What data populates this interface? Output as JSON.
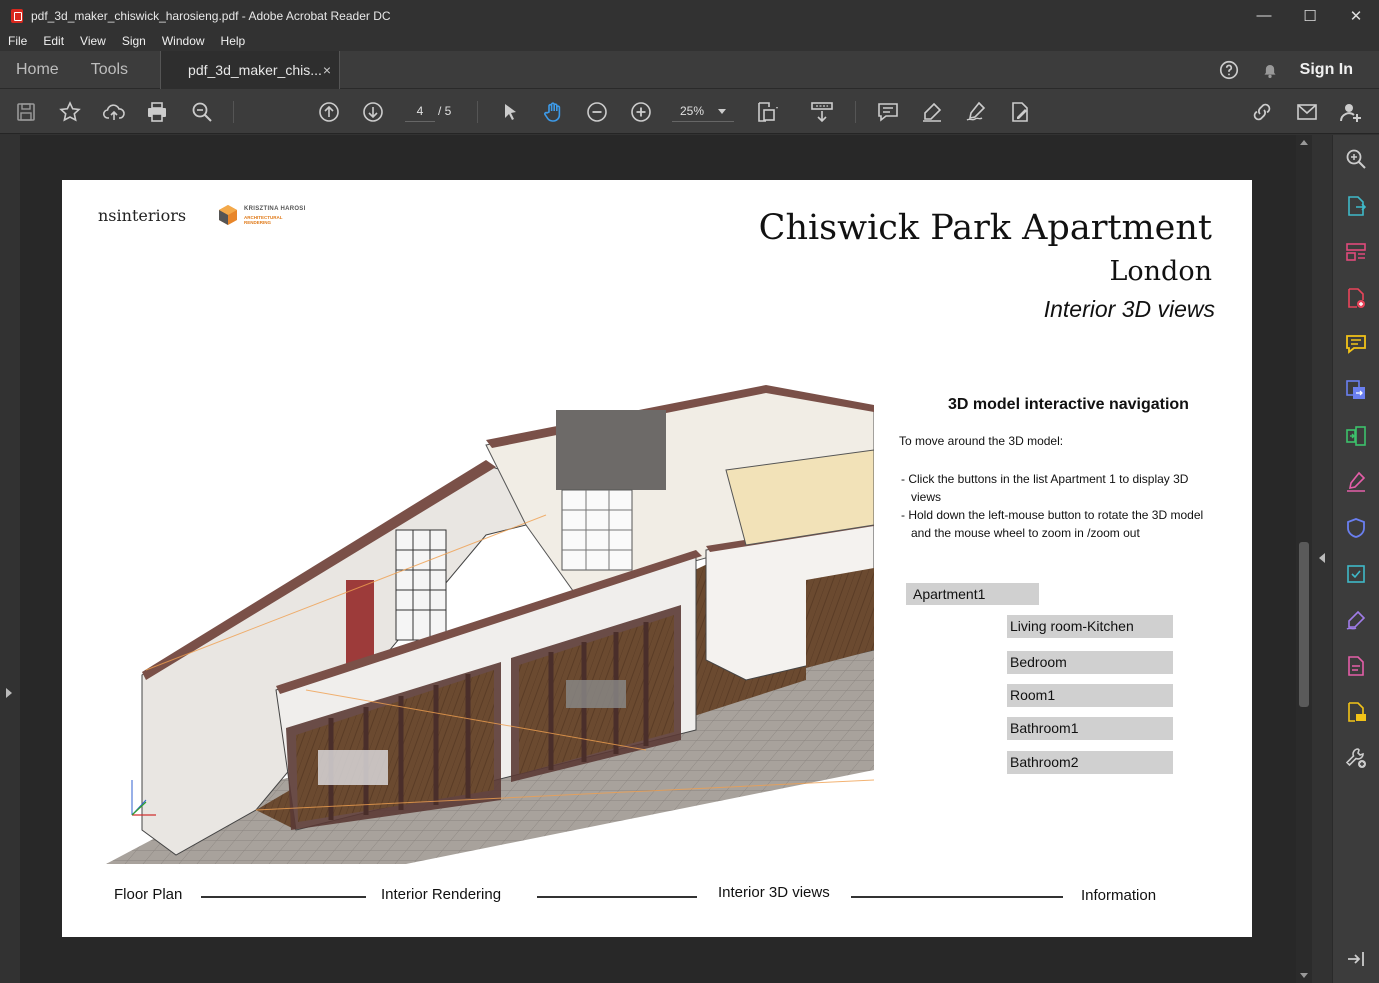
{
  "window": {
    "title": "pdf_3d_maker_chiswick_harosieng.pdf - Adobe Acrobat Reader DC",
    "controls": [
      "—",
      "☐",
      "✕"
    ]
  },
  "menu": [
    "File",
    "Edit",
    "View",
    "Sign",
    "Window",
    "Help"
  ],
  "tabs": {
    "home": "Home",
    "tools": "Tools",
    "document": "pdf_3d_maker_chis...",
    "close": "×",
    "sign_in": "Sign In"
  },
  "toolbar": {
    "page_current": "4",
    "page_total": "/ 5",
    "zoom": "25%"
  },
  "document": {
    "logo_text": "nsinteriors",
    "logo2_line1": "KRISZTINA HAROSI",
    "logo2_line2": "ARCHITECTURAL RENDERING",
    "title": "Chiswick Park Apartment",
    "subtitle": "London",
    "subtitle2": "Interior 3D views",
    "nav": {
      "heading": "3D model interactive navigation",
      "intro": "To move around the 3D model:",
      "bullets": [
        "- Click the buttons in the list Apartment 1 to display 3D views",
        "- Hold down the left-mouse button to rotate the 3D model and the mouse wheel to zoom in /zoom out"
      ],
      "apartment_button": "Apartment1",
      "rooms": [
        "Living room-Kitchen",
        "Bedroom",
        "Room1",
        "Bathroom1",
        "Bathroom2"
      ]
    },
    "footer_nav": [
      "Floor Plan",
      "Interior Rendering",
      "Interior 3D views",
      "Information"
    ]
  },
  "colors": {
    "chrome_dark": "#323232",
    "chrome_mid": "#3c3c3c",
    "doc_bg": "#282828",
    "hand_tool_active": "#3d9ae8",
    "button_gray": "#d0d0d0",
    "wall_brown": "#7a5048"
  },
  "icons": {
    "toolbar": [
      "save-icon",
      "bookmark-star-icon",
      "upload-cloud-icon",
      "print-icon",
      "find-zoom-icon",
      "page-up-icon",
      "page-down-icon",
      "select-arrow-icon",
      "hand-icon",
      "zoom-out-icon",
      "zoom-in-icon",
      "fit-page-icon",
      "scroll-mode-icon",
      "comment-icon",
      "highlight-pen-icon",
      "sign-icon",
      "fill-sign-icon",
      "share-link-icon",
      "email-icon",
      "add-user-icon"
    ],
    "right_panel": [
      "search-zoom-icon",
      "export-pdf-icon",
      "organize-pages-icon",
      "create-pdf-icon",
      "comment-icon",
      "combine-files-icon",
      "compress-icon",
      "fill-sign-icon",
      "protect-icon",
      "convert-icon",
      "request-signature-icon",
      "edit-pdf-icon",
      "send-review-icon",
      "more-tools-icon",
      "collapse-panel-icon"
    ]
  }
}
